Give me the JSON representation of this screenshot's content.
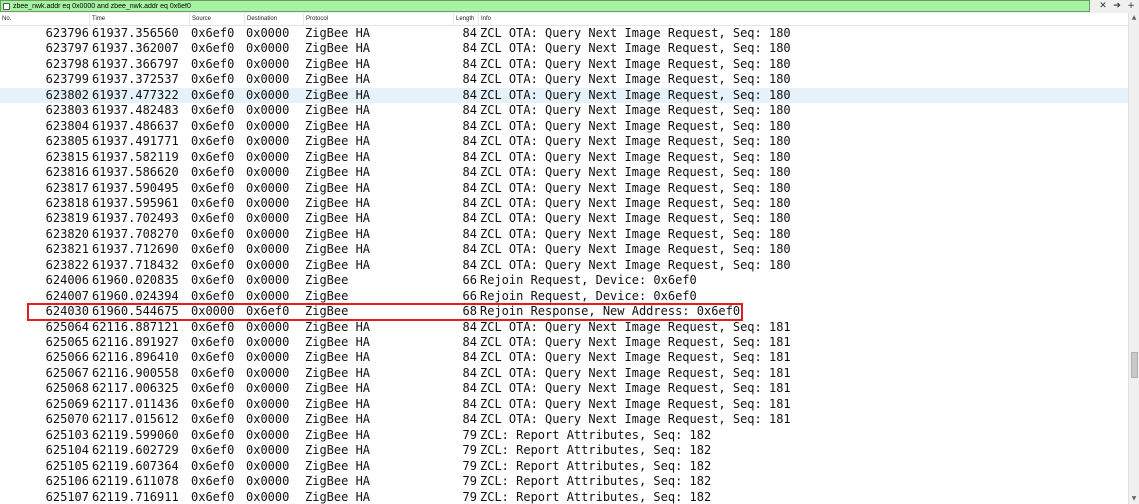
{
  "filter": {
    "value": "zbee_nwk.addr eq 0x0000 and zbee_nwk.addr eq 0x6ef0",
    "clear_glyph": "✕",
    "apply_glyph": "➔",
    "expression_glyph": "+"
  },
  "columns": {
    "no": "No.",
    "time": "Time",
    "source": "Source",
    "destination": "Destination",
    "protocol": "Protocol",
    "length": "Length",
    "info": "Info"
  },
  "packets": [
    {
      "no": "623796",
      "time": "61937.356560",
      "src": "0x6ef0",
      "dst": "0x0000",
      "proto": "ZigBee HA",
      "len": "84",
      "info": "ZCL OTA: Query Next Image Request, Seq: 180"
    },
    {
      "no": "623797",
      "time": "61937.362007",
      "src": "0x6ef0",
      "dst": "0x0000",
      "proto": "ZigBee HA",
      "len": "84",
      "info": "ZCL OTA: Query Next Image Request, Seq: 180"
    },
    {
      "no": "623798",
      "time": "61937.366797",
      "src": "0x6ef0",
      "dst": "0x0000",
      "proto": "ZigBee HA",
      "len": "84",
      "info": "ZCL OTA: Query Next Image Request, Seq: 180"
    },
    {
      "no": "623799",
      "time": "61937.372537",
      "src": "0x6ef0",
      "dst": "0x0000",
      "proto": "ZigBee HA",
      "len": "84",
      "info": "ZCL OTA: Query Next Image Request, Seq: 180"
    },
    {
      "no": "623802",
      "time": "61937.477322",
      "src": "0x6ef0",
      "dst": "0x0000",
      "proto": "ZigBee HA",
      "len": "84",
      "info": "ZCL OTA: Query Next Image Request, Seq: 180"
    },
    {
      "no": "623803",
      "time": "61937.482483",
      "src": "0x6ef0",
      "dst": "0x0000",
      "proto": "ZigBee HA",
      "len": "84",
      "info": "ZCL OTA: Query Next Image Request, Seq: 180"
    },
    {
      "no": "623804",
      "time": "61937.486637",
      "src": "0x6ef0",
      "dst": "0x0000",
      "proto": "ZigBee HA",
      "len": "84",
      "info": "ZCL OTA: Query Next Image Request, Seq: 180"
    },
    {
      "no": "623805",
      "time": "61937.491771",
      "src": "0x6ef0",
      "dst": "0x0000",
      "proto": "ZigBee HA",
      "len": "84",
      "info": "ZCL OTA: Query Next Image Request, Seq: 180"
    },
    {
      "no": "623815",
      "time": "61937.582119",
      "src": "0x6ef0",
      "dst": "0x0000",
      "proto": "ZigBee HA",
      "len": "84",
      "info": "ZCL OTA: Query Next Image Request, Seq: 180"
    },
    {
      "no": "623816",
      "time": "61937.586620",
      "src": "0x6ef0",
      "dst": "0x0000",
      "proto": "ZigBee HA",
      "len": "84",
      "info": "ZCL OTA: Query Next Image Request, Seq: 180"
    },
    {
      "no": "623817",
      "time": "61937.590495",
      "src": "0x6ef0",
      "dst": "0x0000",
      "proto": "ZigBee HA",
      "len": "84",
      "info": "ZCL OTA: Query Next Image Request, Seq: 180"
    },
    {
      "no": "623818",
      "time": "61937.595961",
      "src": "0x6ef0",
      "dst": "0x0000",
      "proto": "ZigBee HA",
      "len": "84",
      "info": "ZCL OTA: Query Next Image Request, Seq: 180"
    },
    {
      "no": "623819",
      "time": "61937.702493",
      "src": "0x6ef0",
      "dst": "0x0000",
      "proto": "ZigBee HA",
      "len": "84",
      "info": "ZCL OTA: Query Next Image Request, Seq: 180"
    },
    {
      "no": "623820",
      "time": "61937.708270",
      "src": "0x6ef0",
      "dst": "0x0000",
      "proto": "ZigBee HA",
      "len": "84",
      "info": "ZCL OTA: Query Next Image Request, Seq: 180"
    },
    {
      "no": "623821",
      "time": "61937.712690",
      "src": "0x6ef0",
      "dst": "0x0000",
      "proto": "ZigBee HA",
      "len": "84",
      "info": "ZCL OTA: Query Next Image Request, Seq: 180"
    },
    {
      "no": "623822",
      "time": "61937.718432",
      "src": "0x6ef0",
      "dst": "0x0000",
      "proto": "ZigBee HA",
      "len": "84",
      "info": "ZCL OTA: Query Next Image Request, Seq: 180"
    },
    {
      "no": "624006",
      "time": "61960.020835",
      "src": "0x6ef0",
      "dst": "0x0000",
      "proto": "ZigBee",
      "len": "66",
      "info": "Rejoin Request, Device: 0x6ef0"
    },
    {
      "no": "624007",
      "time": "61960.024394",
      "src": "0x6ef0",
      "dst": "0x0000",
      "proto": "ZigBee",
      "len": "66",
      "info": "Rejoin Request, Device: 0x6ef0"
    },
    {
      "no": "624030",
      "time": "61960.544675",
      "src": "0x0000",
      "dst": "0x6ef0",
      "proto": "ZigBee",
      "len": "68",
      "info": "Rejoin Response, New Address: 0x6ef0"
    },
    {
      "no": "625064",
      "time": "62116.887121",
      "src": "0x6ef0",
      "dst": "0x0000",
      "proto": "ZigBee HA",
      "len": "84",
      "info": "ZCL OTA: Query Next Image Request, Seq: 181"
    },
    {
      "no": "625065",
      "time": "62116.891927",
      "src": "0x6ef0",
      "dst": "0x0000",
      "proto": "ZigBee HA",
      "len": "84",
      "info": "ZCL OTA: Query Next Image Request, Seq: 181"
    },
    {
      "no": "625066",
      "time": "62116.896410",
      "src": "0x6ef0",
      "dst": "0x0000",
      "proto": "ZigBee HA",
      "len": "84",
      "info": "ZCL OTA: Query Next Image Request, Seq: 181"
    },
    {
      "no": "625067",
      "time": "62116.900558",
      "src": "0x6ef0",
      "dst": "0x0000",
      "proto": "ZigBee HA",
      "len": "84",
      "info": "ZCL OTA: Query Next Image Request, Seq: 181"
    },
    {
      "no": "625068",
      "time": "62117.006325",
      "src": "0x6ef0",
      "dst": "0x0000",
      "proto": "ZigBee HA",
      "len": "84",
      "info": "ZCL OTA: Query Next Image Request, Seq: 181"
    },
    {
      "no": "625069",
      "time": "62117.011436",
      "src": "0x6ef0",
      "dst": "0x0000",
      "proto": "ZigBee HA",
      "len": "84",
      "info": "ZCL OTA: Query Next Image Request, Seq: 181"
    },
    {
      "no": "625070",
      "time": "62117.015612",
      "src": "0x6ef0",
      "dst": "0x0000",
      "proto": "ZigBee HA",
      "len": "84",
      "info": "ZCL OTA: Query Next Image Request, Seq: 181"
    },
    {
      "no": "625103",
      "time": "62119.599060",
      "src": "0x6ef0",
      "dst": "0x0000",
      "proto": "ZigBee HA",
      "len": "79",
      "info": "ZCL: Report Attributes, Seq: 182"
    },
    {
      "no": "625104",
      "time": "62119.602729",
      "src": "0x6ef0",
      "dst": "0x0000",
      "proto": "ZigBee HA",
      "len": "79",
      "info": "ZCL: Report Attributes, Seq: 182"
    },
    {
      "no": "625105",
      "time": "62119.607364",
      "src": "0x6ef0",
      "dst": "0x0000",
      "proto": "ZigBee HA",
      "len": "79",
      "info": "ZCL: Report Attributes, Seq: 182"
    },
    {
      "no": "625106",
      "time": "62119.611078",
      "src": "0x6ef0",
      "dst": "0x0000",
      "proto": "ZigBee HA",
      "len": "79",
      "info": "ZCL: Report Attributes, Seq: 182"
    },
    {
      "no": "625107",
      "time": "62119.716911",
      "src": "0x6ef0",
      "dst": "0x0000",
      "proto": "ZigBee HA",
      "len": "79",
      "info": "ZCL: Report Attributes, Seq: 182"
    }
  ],
  "selected_packet": "623802",
  "highlighted_packet": "624030",
  "colors": {
    "filter_valid": "#a6f4a1",
    "selected_row": "#e6f1fa",
    "highlight_box": "#e0201e"
  }
}
